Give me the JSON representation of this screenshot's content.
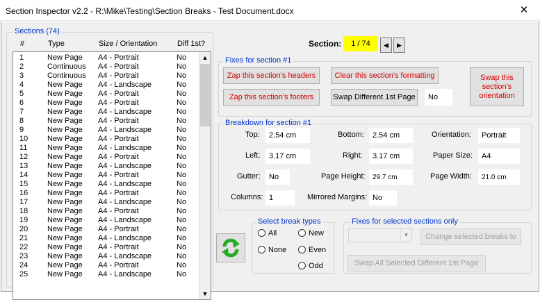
{
  "window": {
    "title": "Section Inspector v2.2 - R:\\Mike\\Testing\\Section Breaks - Test Document.docx",
    "close_glyph": "✕"
  },
  "sections": {
    "label": "Sections (74)",
    "columns": [
      "#",
      "Type",
      "Size / Orientation",
      "Diff 1st?"
    ],
    "rows": [
      [
        "1",
        "New Page",
        "A4 - Portrait",
        "No"
      ],
      [
        "2",
        "Continuous",
        "A4 - Portrait",
        "No"
      ],
      [
        "3",
        "Continuous",
        "A4 - Portrait",
        "No"
      ],
      [
        "4",
        "New Page",
        "A4 - Landscape",
        "No"
      ],
      [
        "5",
        "New Page",
        "A4 - Portrait",
        "No"
      ],
      [
        "6",
        "New Page",
        "A4 - Portrait",
        "No"
      ],
      [
        "7",
        "New Page",
        "A4 - Landscape",
        "No"
      ],
      [
        "8",
        "New Page",
        "A4 - Portrait",
        "No"
      ],
      [
        "9",
        "New Page",
        "A4 - Landscape",
        "No"
      ],
      [
        "10",
        "New Page",
        "A4 - Portrait",
        "No"
      ],
      [
        "11",
        "New Page",
        "A4 - Landscape",
        "No"
      ],
      [
        "12",
        "New Page",
        "A4 - Portrait",
        "No"
      ],
      [
        "13",
        "New Page",
        "A4 - Landscape",
        "No"
      ],
      [
        "14",
        "New Page",
        "A4 - Portrait",
        "No"
      ],
      [
        "15",
        "New Page",
        "A4 - Landscape",
        "No"
      ],
      [
        "16",
        "New Page",
        "A4 - Portrait",
        "No"
      ],
      [
        "17",
        "New Page",
        "A4 - Landscape",
        "No"
      ],
      [
        "18",
        "New Page",
        "A4 - Portrait",
        "No"
      ],
      [
        "19",
        "New Page",
        "A4 - Landscape",
        "No"
      ],
      [
        "20",
        "New Page",
        "A4 - Portrait",
        "No"
      ],
      [
        "21",
        "New Page",
        "A4 - Landscape",
        "No"
      ],
      [
        "22",
        "New Page",
        "A4 - Portrait",
        "No"
      ],
      [
        "23",
        "New Page",
        "A4 - Landscape",
        "No"
      ],
      [
        "24",
        "New Page",
        "A4 - Portrait",
        "No"
      ],
      [
        "25",
        "New Page",
        "A4 - Landscape",
        "No"
      ]
    ]
  },
  "navigator": {
    "label": "Section:",
    "value": "1 / 74",
    "prev_glyph": "◀",
    "next_glyph": "▶",
    "highlight_color": "#ffff00"
  },
  "fixes": {
    "label": "Fixes for section #1",
    "zap_headers": "Zap this section's headers",
    "zap_footers": "Zap this section's footers",
    "clear_formatting": "Clear this section's formatting",
    "swap_diff_first": "Swap Different 1st Page",
    "diff_first_value": "No",
    "swap_orientation": "Swap this section's orientation"
  },
  "breakdown": {
    "label": "Breakdown for section #1",
    "top_label": "Top:",
    "top": "2.54 cm",
    "bottom_label": "Bottom:",
    "bottom": "2.54 cm",
    "orientation_label": "Orientation:",
    "orientation": "Portrait",
    "left_label": "Left:",
    "left": "3.17 cm",
    "right_label": "Right:",
    "right": "3.17 cm",
    "paper_size_label": "Paper Size:",
    "paper_size": "A4",
    "gutter_label": "Gutter:",
    "gutter": "No",
    "page_height_label": "Page Height:",
    "page_height": "29.7 cm",
    "page_width_label": "Page Width:",
    "page_width": "21.0 cm",
    "columns_label": "Columns:",
    "columns": "1",
    "mirrored_label": "Mirrored Margins:",
    "mirrored": "No"
  },
  "refresh": {
    "icon": "refresh-icon",
    "color": "#22aa22"
  },
  "break_types": {
    "label": "Select break types",
    "all": "All",
    "new": "New",
    "none": "None",
    "even": "Even",
    "odd": "Odd"
  },
  "selected_fixes": {
    "label": "Fixes for selected sections only",
    "dropdown_value": "",
    "change_breaks": "Change selected breaks to",
    "swap_diff_first": "Swap All Selected Different 1st Page"
  },
  "colors": {
    "legend": "#0033cc",
    "danger": "#d40000",
    "disabled": "#a0a0a0"
  }
}
